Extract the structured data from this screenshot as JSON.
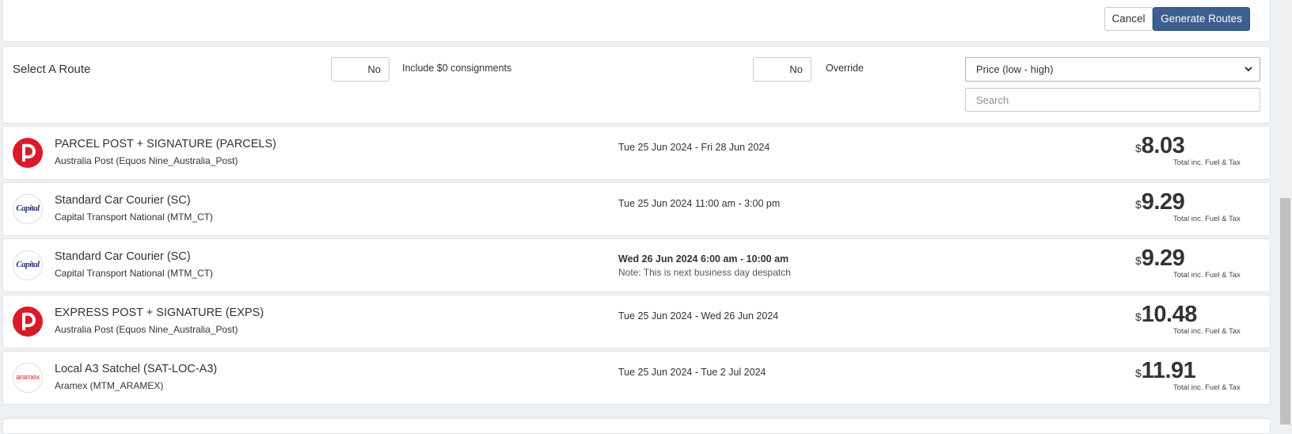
{
  "toolbar": {
    "cancel_label": "Cancel",
    "generate_label": "Generate Routes"
  },
  "filter": {
    "title": "Select A Route",
    "include_zero_toggle": "No",
    "include_zero_label": "Include $0 consignments",
    "override_toggle": "No",
    "override_label": "Override",
    "sort_selected": "Price (low - high)",
    "search_placeholder": "Search"
  },
  "routes": [
    {
      "logo": "australia-post",
      "name": "PARCEL POST + SIGNATURE (PARCELS)",
      "carrier": "Australia Post (Equos Nine_Australia_Post)",
      "date": "Tue 25 Jun 2024 - Fri 28 Jun 2024",
      "note": "",
      "currency": "$",
      "price": "8.03",
      "price_note": "Total inc. Fuel & Tax"
    },
    {
      "logo": "capital-transport",
      "name": "Standard Car Courier (SC)",
      "carrier": "Capital Transport National (MTM_CT)",
      "date": "Tue 25 Jun 2024 11:00 am - 3:00 pm",
      "note": "",
      "currency": "$",
      "price": "9.29",
      "price_note": "Total inc. Fuel & Tax"
    },
    {
      "logo": "capital-transport",
      "name": "Standard Car Courier (SC)",
      "carrier": "Capital Transport National (MTM_CT)",
      "date": "Wed 26 Jun 2024 6:00 am - 10:00 am",
      "note": "Note: This is next business day despatch",
      "currency": "$",
      "price": "9.29",
      "price_note": "Total inc. Fuel & Tax"
    },
    {
      "logo": "australia-post",
      "name": "EXPRESS POST + SIGNATURE (EXPS)",
      "carrier": "Australia Post (Equos Nine_Australia_Post)",
      "date": "Tue 25 Jun 2024 - Wed 26 Jun 2024",
      "note": "",
      "currency": "$",
      "price": "10.48",
      "price_note": "Total inc. Fuel & Tax"
    },
    {
      "logo": "aramex",
      "name": "Local A3 Satchel (SAT-LOC-A3)",
      "carrier": "Aramex (MTM_ARAMEX)",
      "date": "Tue 25 Jun 2024 - Tue 2 Jul 2024",
      "note": "",
      "currency": "$",
      "price": "11.91",
      "price_note": "Total inc. Fuel & Tax"
    }
  ],
  "logos": {
    "capital_text": "Capital",
    "aramex_text": "aramex"
  },
  "colors": {
    "primary": "#3d5f8f",
    "auspost_red": "#dc1928",
    "capital_blue": "#27327a",
    "aramex_red": "#e1262d"
  }
}
